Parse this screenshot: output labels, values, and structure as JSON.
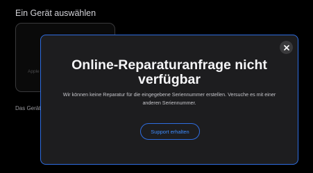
{
  "background": {
    "title": "Ein Gerät auswählen",
    "card_label": "Apple",
    "footer_text": "Das Gerät"
  },
  "modal": {
    "title": "Online-Reparaturanfrage nicht verfügbar",
    "message": "Wir können keine Reparatur für die eingegebene Seriennummer erstellen. Versuche es mit einer anderen Seriennummer.",
    "support_button_label": "Support erhalten",
    "close_icon": "close-icon",
    "accent_color": "#2f6ee2",
    "link_color": "#3d8bff"
  }
}
